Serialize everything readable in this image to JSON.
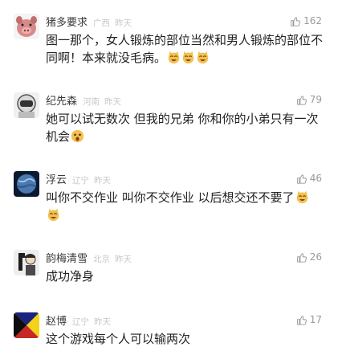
{
  "comments": [
    {
      "username": "猪多要求",
      "location": "广西",
      "time": "昨天",
      "likes": "162",
      "avatar": "pig-icon",
      "text": "图一那个，女人锻炼的部位当然和男人锻炼的部位不同啊！本来就没毛病。",
      "emoji": "cat-laugh-emoji",
      "emoji_count": 3
    },
    {
      "username": "纪先森",
      "location": "河南",
      "time": "昨天",
      "likes": "79",
      "avatar": "astronaut-icon",
      "text": "她可以试无数次 但我的兄弟 你和你的小弟只有一次机会",
      "emoji": "shocked-face-emoji",
      "emoji_count": 1
    },
    {
      "username": "浮云",
      "location": "辽宁",
      "time": "昨天",
      "likes": "46",
      "avatar": "planet-icon",
      "text": "叫你不交作业 叫你不交作业 以后想交还不要了",
      "emoji": "cat-laugh-emoji",
      "emoji_count": 2
    },
    {
      "username": "韵梅清雪",
      "location": "北京",
      "time": "昨天",
      "likes": "26",
      "avatar": "character-icon",
      "text": "成功净身",
      "emoji": "",
      "emoji_count": 0
    },
    {
      "username": "赵博",
      "location": "辽宁",
      "time": "昨天",
      "likes": "17",
      "avatar": "geometric-logo-icon",
      "text": "这个游戏每个人可以输两次",
      "emoji": "",
      "emoji_count": 0
    }
  ],
  "colors": {
    "name": "#3a3a3a",
    "meta": "#c8c8c8",
    "likes": "#9a9a9a",
    "text": "#222222"
  }
}
